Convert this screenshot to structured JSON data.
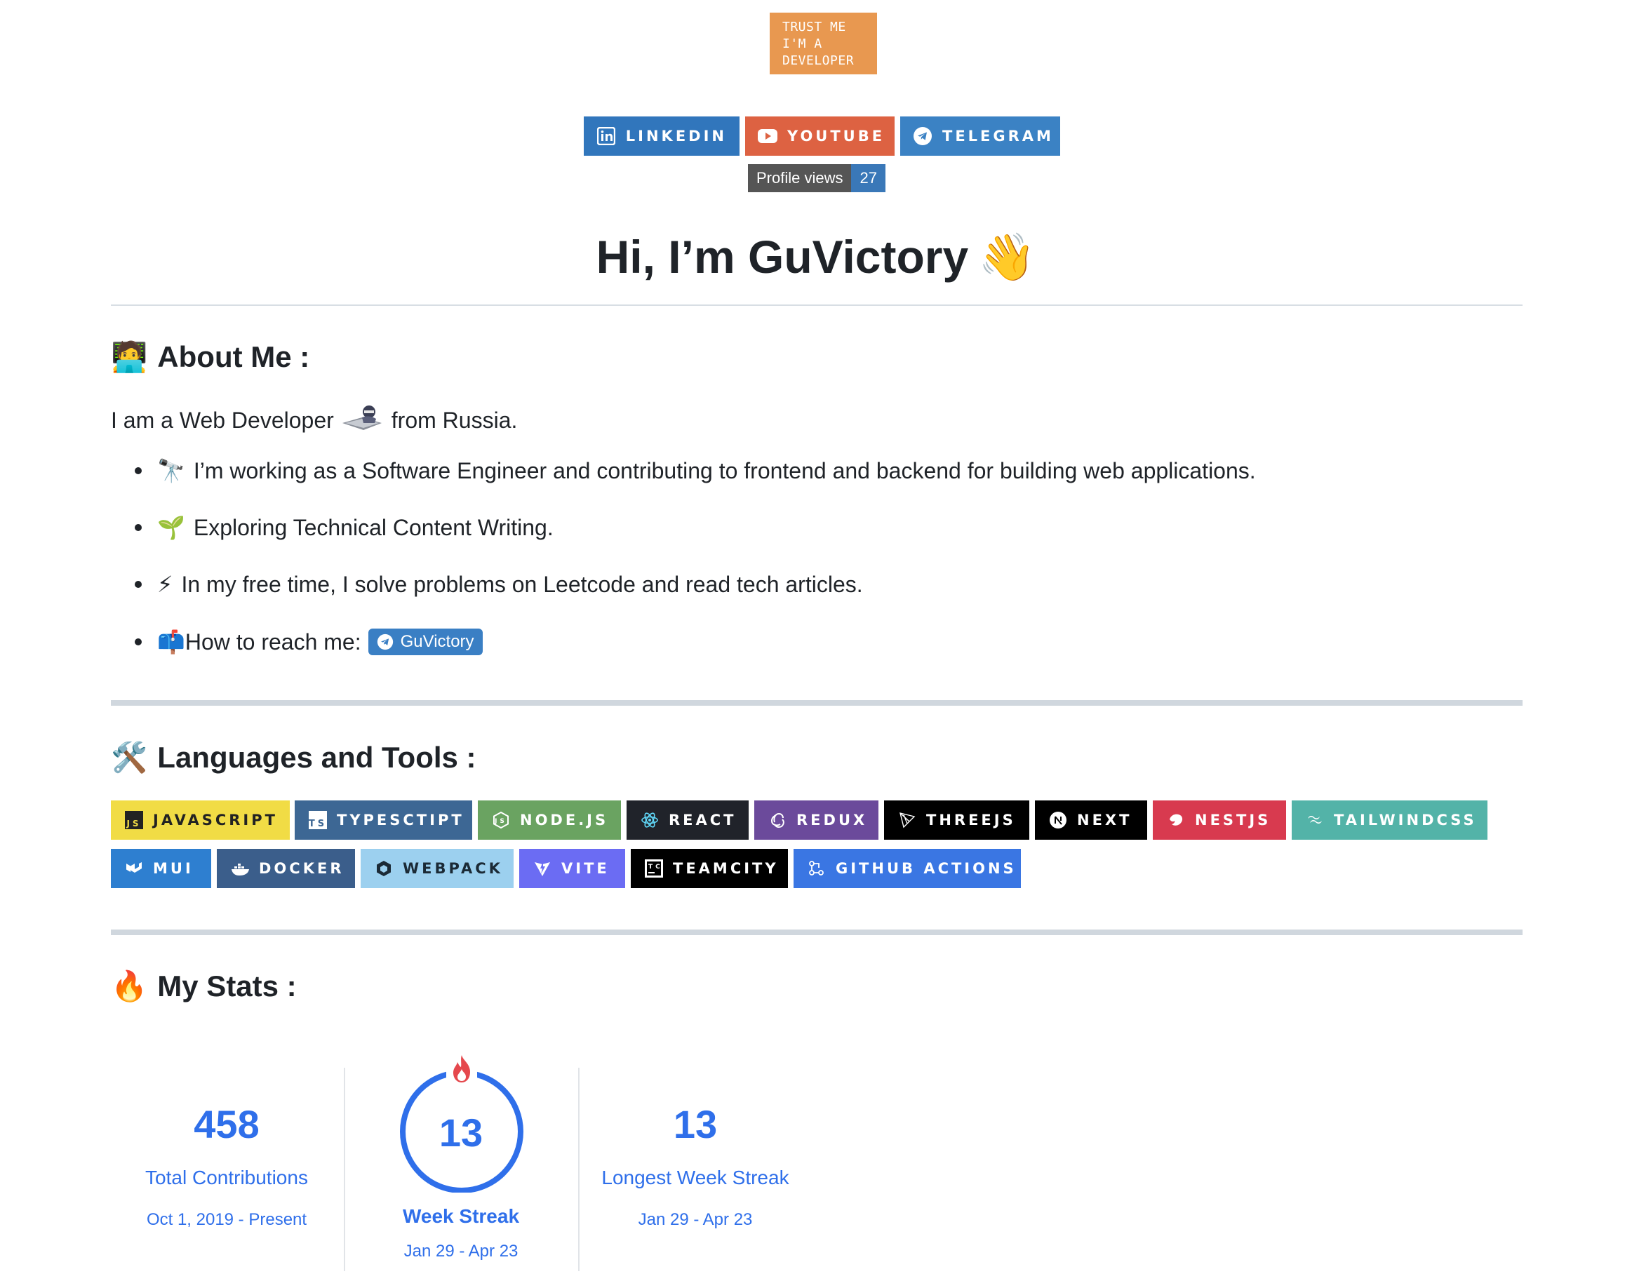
{
  "banner": {
    "lines": [
      "TRUST ME",
      "I'M A",
      "DEVELOPER"
    ]
  },
  "social": [
    {
      "label": "LINKEDIN",
      "icon": "linkedin-icon",
      "color": "#3176bc"
    },
    {
      "label": "YOUTUBE",
      "icon": "youtube-icon",
      "color": "#dd6242"
    },
    {
      "label": "TELEGRAM",
      "icon": "telegram-icon",
      "color": "#3b82c4"
    }
  ],
  "profile_views": {
    "label": "Profile views",
    "count": "27"
  },
  "title": {
    "text": "Hi, I’m GuVictory",
    "emoji": "👋"
  },
  "about": {
    "heading": "About Me :",
    "heading_emoji": "🧑‍💻",
    "intro_before": "I am a Web Developer",
    "intro_after": "from Russia.",
    "bullets": [
      {
        "emoji": "🔭",
        "text": "I’m working as a Software Engineer and contributing to frontend and backend for building web applications."
      },
      {
        "emoji": "🌱",
        "text": "Exploring Technical Content Writing."
      },
      {
        "emoji": "⚡",
        "text": "In my free time, I solve problems on Leetcode and read tech articles."
      },
      {
        "emoji": "📫",
        "text": "How to reach me:"
      }
    ],
    "contact_chip": "GuVictory"
  },
  "tools": {
    "heading": "Languages and Tools :",
    "heading_emoji": "🛠️",
    "row1": [
      {
        "label": "JAVASCRIPT",
        "bg": "#f1dc45",
        "fg": "#222222"
      },
      {
        "label": "TYPESCTIPT",
        "bg": "#3d6794"
      },
      {
        "label": "NODE.JS",
        "bg": "#6aa361"
      },
      {
        "label": "REACT",
        "bg": "#20232a"
      },
      {
        "label": "REDUX",
        "bg": "#6b4a9b"
      },
      {
        "label": "THREEJS",
        "bg": "#000000"
      },
      {
        "label": "NEXT",
        "bg": "#000000"
      },
      {
        "label": "NESTJS",
        "bg": "#d83a4f"
      },
      {
        "label": "TAILWINDCSS",
        "bg": "#53b3a8"
      }
    ],
    "row2": [
      {
        "label": "MUI",
        "bg": "#2e7fd0"
      },
      {
        "label": "DOCKER",
        "bg": "#3b5e8b"
      },
      {
        "label": "WEBPACK",
        "bg": "#9cd0ef",
        "fg": "#1b2a36"
      },
      {
        "label": "VITE",
        "bg": "#6b6cf3"
      },
      {
        "label": "TEAMCITY",
        "bg": "#000000"
      },
      {
        "label": "GITHUB ACTIONS",
        "bg": "#3a76e3"
      }
    ]
  },
  "stats": {
    "heading": "My Stats :",
    "heading_emoji": "🔥",
    "total": {
      "value": "458",
      "label": "Total Contributions",
      "range": "Oct 1, 2019 - Present"
    },
    "current": {
      "value": "13",
      "label": "Week Streak",
      "range": "Jan 29 - Apr 23"
    },
    "longest": {
      "value": "13",
      "label": "Longest Week Streak",
      "range": "Jan 29 - Apr 23"
    }
  }
}
